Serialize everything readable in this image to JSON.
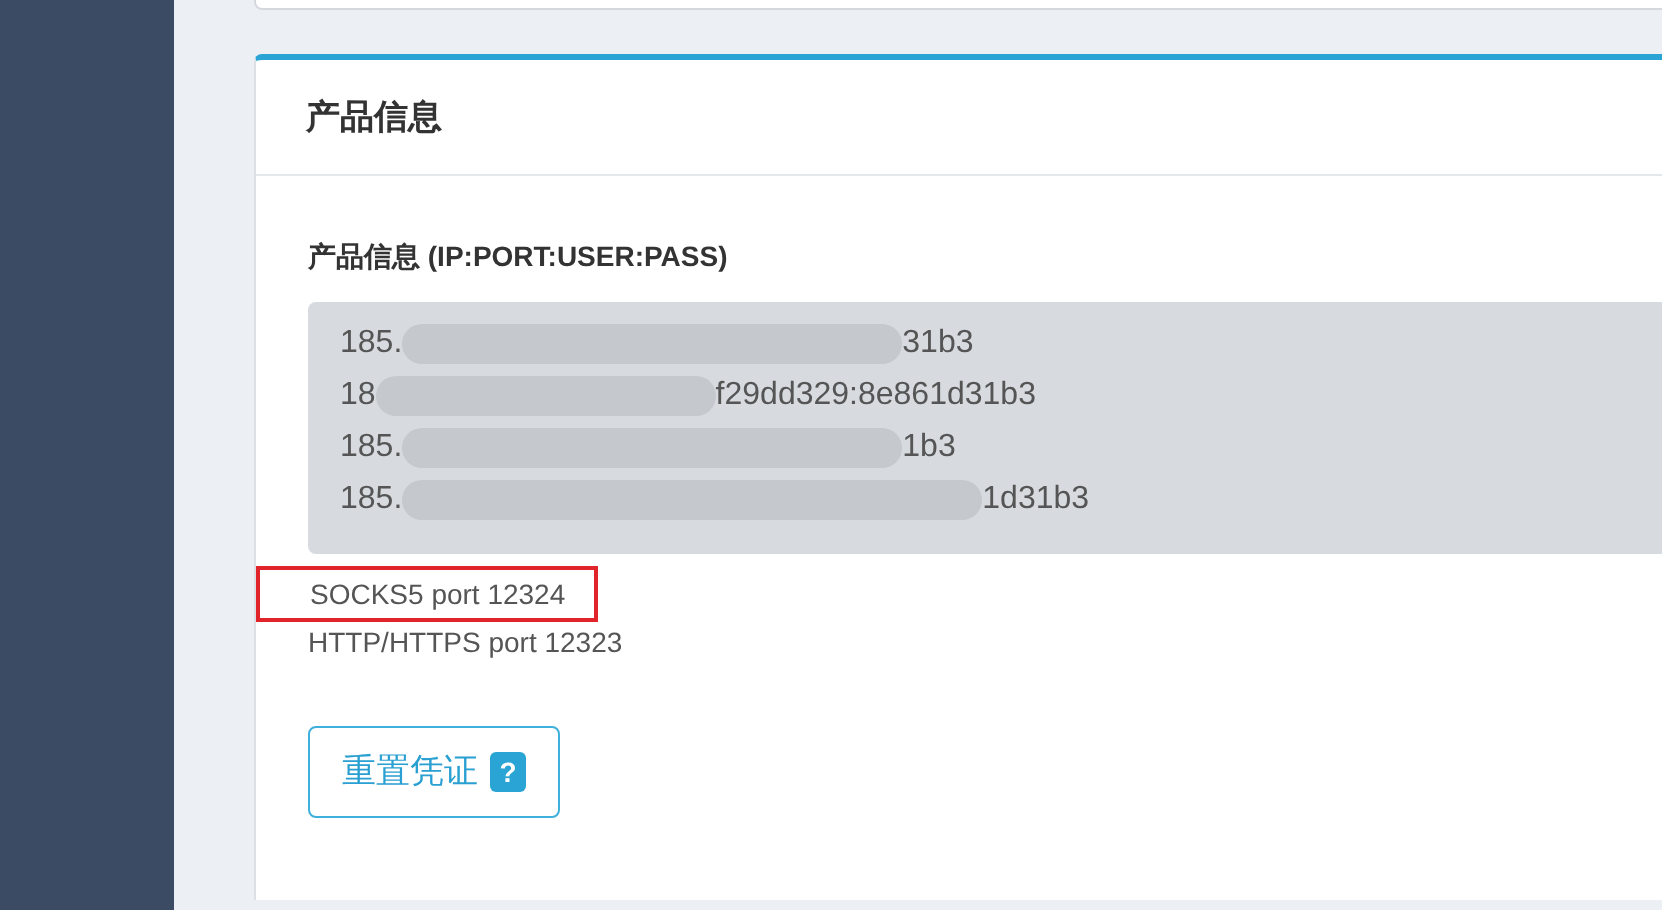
{
  "card": {
    "title": "产品信息"
  },
  "credentials": {
    "label": "产品信息 (IP:PORT:USER:PASS)",
    "lines": [
      {
        "start": "185.",
        "end": "31b3"
      },
      {
        "start": "18",
        "end": "f29dd329:8e861d31b3"
      },
      {
        "start": "185.",
        "end": "1b3"
      },
      {
        "start": "185.",
        "end": "1d31b3"
      }
    ]
  },
  "ports": [
    {
      "text": "SOCKS5 port 12324",
      "highlighted": true
    },
    {
      "text": "HTTP/HTTPS port 12323",
      "highlighted": false
    }
  ],
  "reset_button": {
    "label": "重置凭证",
    "help": "?"
  }
}
